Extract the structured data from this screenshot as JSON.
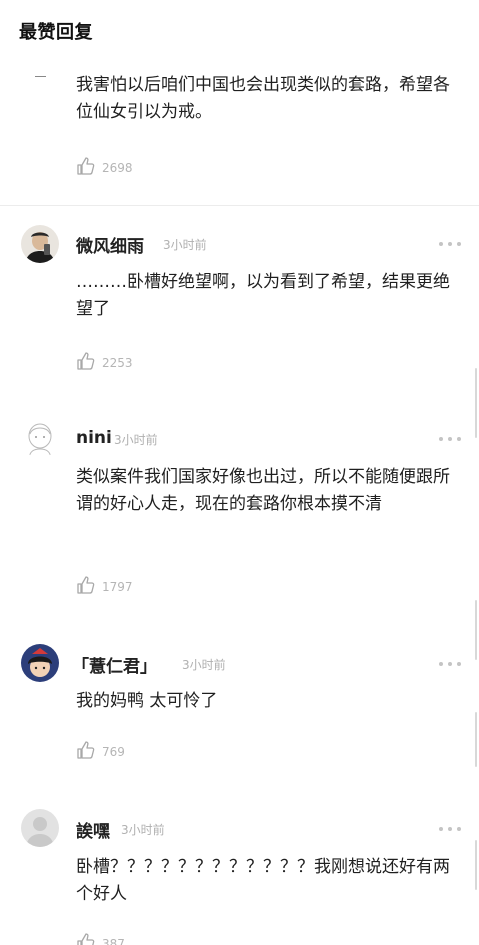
{
  "section_title": "最赞回复",
  "comments": [
    {
      "username": "",
      "time": "",
      "content": "我害怕以后咱们中国也会出现类似的套路，希望各位仙女引以为戒。",
      "likes": "2698"
    },
    {
      "username": "微风细雨",
      "time": "3小时前",
      "content": "………卧槽好绝望啊，以为看到了希望，结果更绝望了",
      "likes": "2253"
    },
    {
      "username": "nini",
      "time": "3小时前",
      "content": "类似案件我们国家好像也出过，所以不能随便跟所谓的好心人走，现在的套路你根本摸不清",
      "likes": "1797"
    },
    {
      "username": "「薏仁君」",
      "time": "3小时前",
      "content": "我的妈鸭  太可怜了",
      "likes": "769"
    },
    {
      "username": "誒嘿",
      "time": "3小时前",
      "content": "卧槽？？？？？？？？？？？？我刚想说还好有两个好人",
      "likes": "387"
    }
  ],
  "icons": {
    "like": "thumbs-up-icon",
    "more": "more-dots-icon"
  }
}
